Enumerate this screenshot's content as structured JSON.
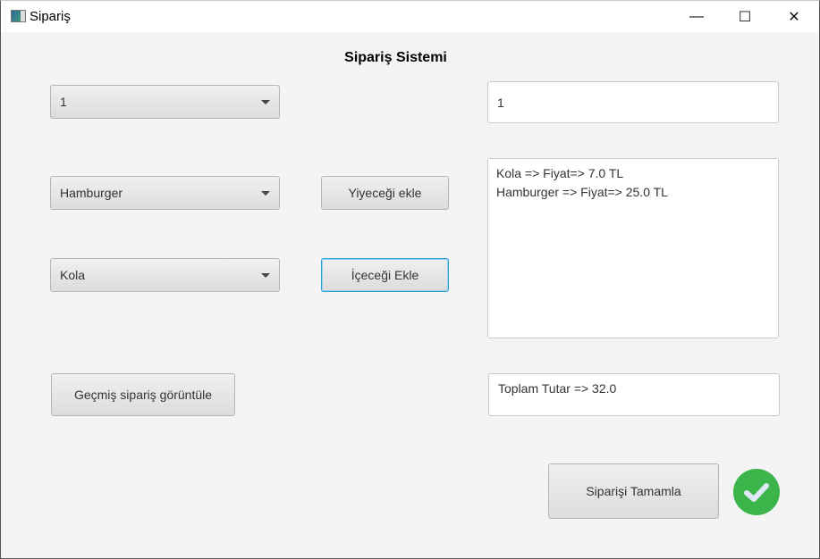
{
  "window": {
    "title": "Sipariş",
    "minimize": "—",
    "maximize": "☐",
    "close": "✕"
  },
  "heading": "Sipariş Sistemi",
  "quantity_combo": {
    "value": "1"
  },
  "food_combo": {
    "value": "Hamburger"
  },
  "drink_combo": {
    "value": "Kola"
  },
  "add_food_label": "Yiyeceği ekle",
  "add_drink_label": "İçeceği Ekle",
  "history_label": "Geçmiş sipariş görüntüle",
  "quantity_field": "1",
  "order_list": [
    "Kola => Fiyat=> 7.0 TL",
    "Hamburger => Fiyat=> 25.0 TL"
  ],
  "total": "Toplam Tutar => 32.0",
  "complete_label": "Siparişi Tamamla",
  "status_icon": "check-circle-icon",
  "colors": {
    "accent": "#2a9fd6",
    "success": "#3bb54a"
  }
}
